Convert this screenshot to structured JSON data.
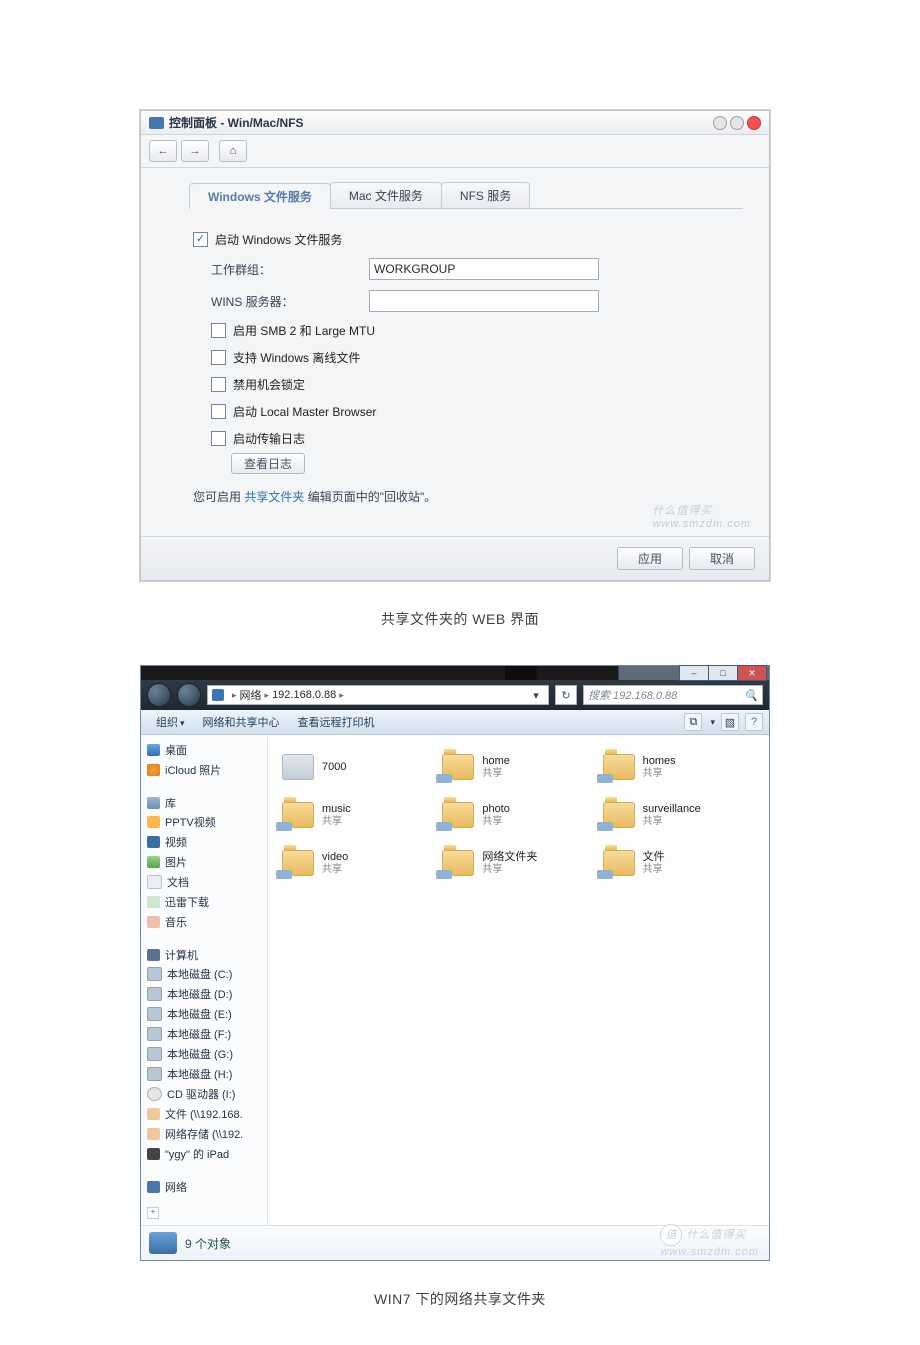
{
  "captions": {
    "cap1": "共享文件夹的 WEB 界面",
    "cap2": "WIN7 下的网络共享文件夹"
  },
  "watermark": {
    "brand_cn": "什么值得买",
    "site": "www.smzdm.com",
    "badge": "值"
  },
  "cp": {
    "title": "控制面板 - Win/Mac/NFS",
    "nav": {
      "back": "←",
      "forward": "→",
      "home": "⌂"
    },
    "tabs": {
      "win": "Windows 文件服务",
      "mac": "Mac 文件服务",
      "nfs": "NFS 服务"
    },
    "opt": {
      "enable_win": "启动 Windows 文件服务",
      "workgroup_label": "工作群组：",
      "workgroup_value": "WORKGROUP",
      "wins_label": "WINS 服务器：",
      "wins_value": "",
      "smb2": "启用 SMB 2 和 Large MTU",
      "offline": "支持 Windows 离线文件",
      "oplock": "禁用机会锁定",
      "lmb": "启动 Local Master Browser",
      "log": "启动传输日志",
      "viewlog": "查看日志"
    },
    "hint_pre": "您可启用 ",
    "hint_link": "共享文件夹",
    "hint_post": " 编辑页面中的\"回收站\"。",
    "buttons": {
      "apply": "应用",
      "cancel": "取消"
    }
  },
  "ex": {
    "win_buttons": {
      "min": "–",
      "max": "□",
      "close": "✕"
    },
    "crumbs": {
      "net": "网络",
      "node": "192.168.0.88"
    },
    "search_placeholder": "搜索 192.168.0.88",
    "search_icon": "🔍",
    "refresh": "↻",
    "addr_drop": "▾",
    "cmd": {
      "organize": "组织",
      "netcenter": "网络和共享中心",
      "printers": "查看远程打印机",
      "view": "⧉",
      "preview": "▧",
      "help": "?"
    },
    "side": {
      "desktop": "桌面",
      "icloud": "iCloud 照片",
      "libraries": "库",
      "pptv": "PPTV视频",
      "videos": "视频",
      "pictures": "图片",
      "documents": "文档",
      "downloads": "迅雷下载",
      "music": "音乐",
      "computer": "计算机",
      "volC": "本地磁盘 (C:)",
      "volD": "本地磁盘 (D:)",
      "volE": "本地磁盘 (E:)",
      "volF": "本地磁盘 (F:)",
      "volG": "本地磁盘 (G:)",
      "volH": "本地磁盘 (H:)",
      "cd": "CD 驱动器 (I:)",
      "netdrv1": "文件 (\\\\192.168.",
      "netdrv2": "网络存储 (\\\\192.",
      "ipad": "\"ygy\" 的 iPad",
      "network": "网络",
      "expand": "+"
    },
    "share_label": "共享",
    "folders": [
      {
        "name": "7000",
        "sub": "",
        "type": "hdd"
      },
      {
        "name": "home",
        "sub": "共享",
        "type": "share"
      },
      {
        "name": "homes",
        "sub": "共享",
        "type": "share"
      },
      {
        "name": "music",
        "sub": "共享",
        "type": "share"
      },
      {
        "name": "photo",
        "sub": "共享",
        "type": "share"
      },
      {
        "name": "surveillance",
        "sub": "共享",
        "type": "share"
      },
      {
        "name": "video",
        "sub": "共享",
        "type": "share"
      },
      {
        "name": "网络文件夹",
        "sub": "共享",
        "type": "share"
      },
      {
        "name": "文件",
        "sub": "共享",
        "type": "share"
      }
    ],
    "status": "9 个对象"
  }
}
